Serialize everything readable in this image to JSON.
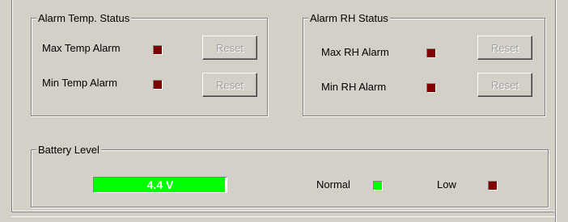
{
  "temp_group": {
    "title": "Alarm Temp. Status",
    "max_label": "Max Temp Alarm",
    "min_label": "Min Temp Alarm",
    "reset_label": "Reset"
  },
  "rh_group": {
    "title": "Alarm RH Status",
    "max_label": "Max RH Alarm",
    "min_label": "Min RH Alarm",
    "reset_label": "Reset"
  },
  "battery_group": {
    "title": "Battery Level",
    "value_text": "4.4 V",
    "level_fraction": 0.99,
    "normal_label": "Normal",
    "low_label": "Low"
  },
  "colors": {
    "alarm_led": "#800000",
    "normal_led": "#00ff00",
    "low_led": "#800000",
    "battery_fill": "#00ff00"
  },
  "icons": {
    "led": "square-indicator-icon"
  }
}
